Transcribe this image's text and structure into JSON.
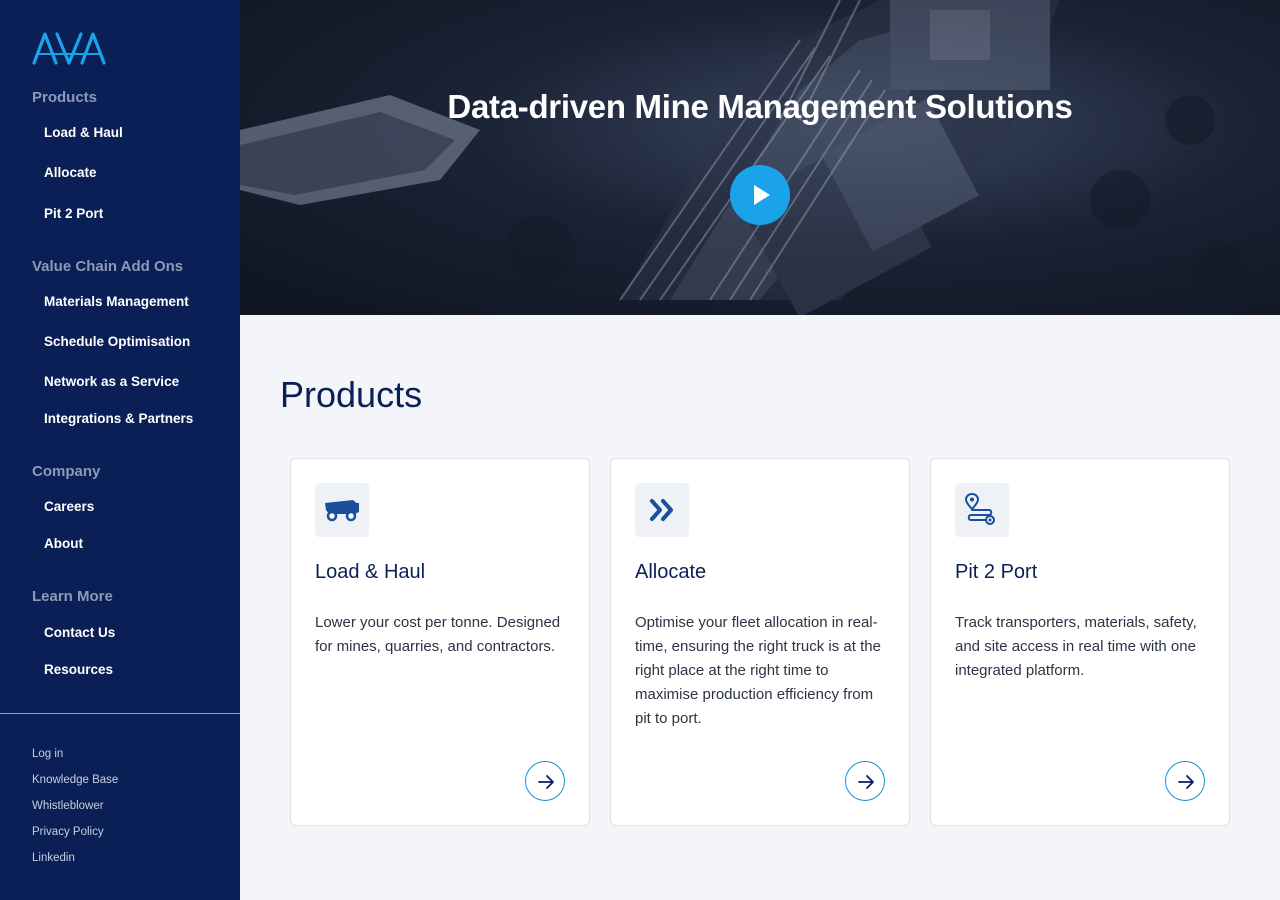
{
  "brand": {
    "logo_text": "AVA",
    "accent_color": "#1aa3e8",
    "navy": "#0a1f55"
  },
  "sidebar": {
    "groups": [
      {
        "title": "Products",
        "items": [
          "Load & Haul",
          "Allocate",
          "Pit 2 Port"
        ]
      },
      {
        "title": "Value Chain Add Ons",
        "items": [
          "Materials Management",
          "Schedule Optimisation",
          "Network as a Service",
          "Integrations & Partners"
        ]
      },
      {
        "title": "Company",
        "items": [
          "Careers",
          "About"
        ]
      },
      {
        "title": "Learn More",
        "items": [
          "Contact Us",
          "Resources"
        ]
      }
    ],
    "footer_links": [
      "Log in",
      "Knowledge Base",
      "Whistleblower",
      "Privacy Policy",
      "Linkedin"
    ]
  },
  "hero": {
    "title": "Data-driven Mine Management Solutions",
    "play_icon": "play-icon"
  },
  "products": {
    "heading": "Products",
    "cards": [
      {
        "icon": "haul-truck-icon",
        "title": "Load & Haul",
        "description": "Lower your cost per tonne. Designed for mines, quarries, and contractors."
      },
      {
        "icon": "double-chevron-right-icon",
        "title": "Allocate",
        "description": "Optimise your fleet allocation in real-time, ensuring the right truck is at the right place at the right time to maximise production efficiency from pit to port."
      },
      {
        "icon": "route-pin-icon",
        "title": "Pit 2 Port",
        "description": "Track transporters, materials, safety, and site access in real time with one integrated platform."
      }
    ]
  }
}
